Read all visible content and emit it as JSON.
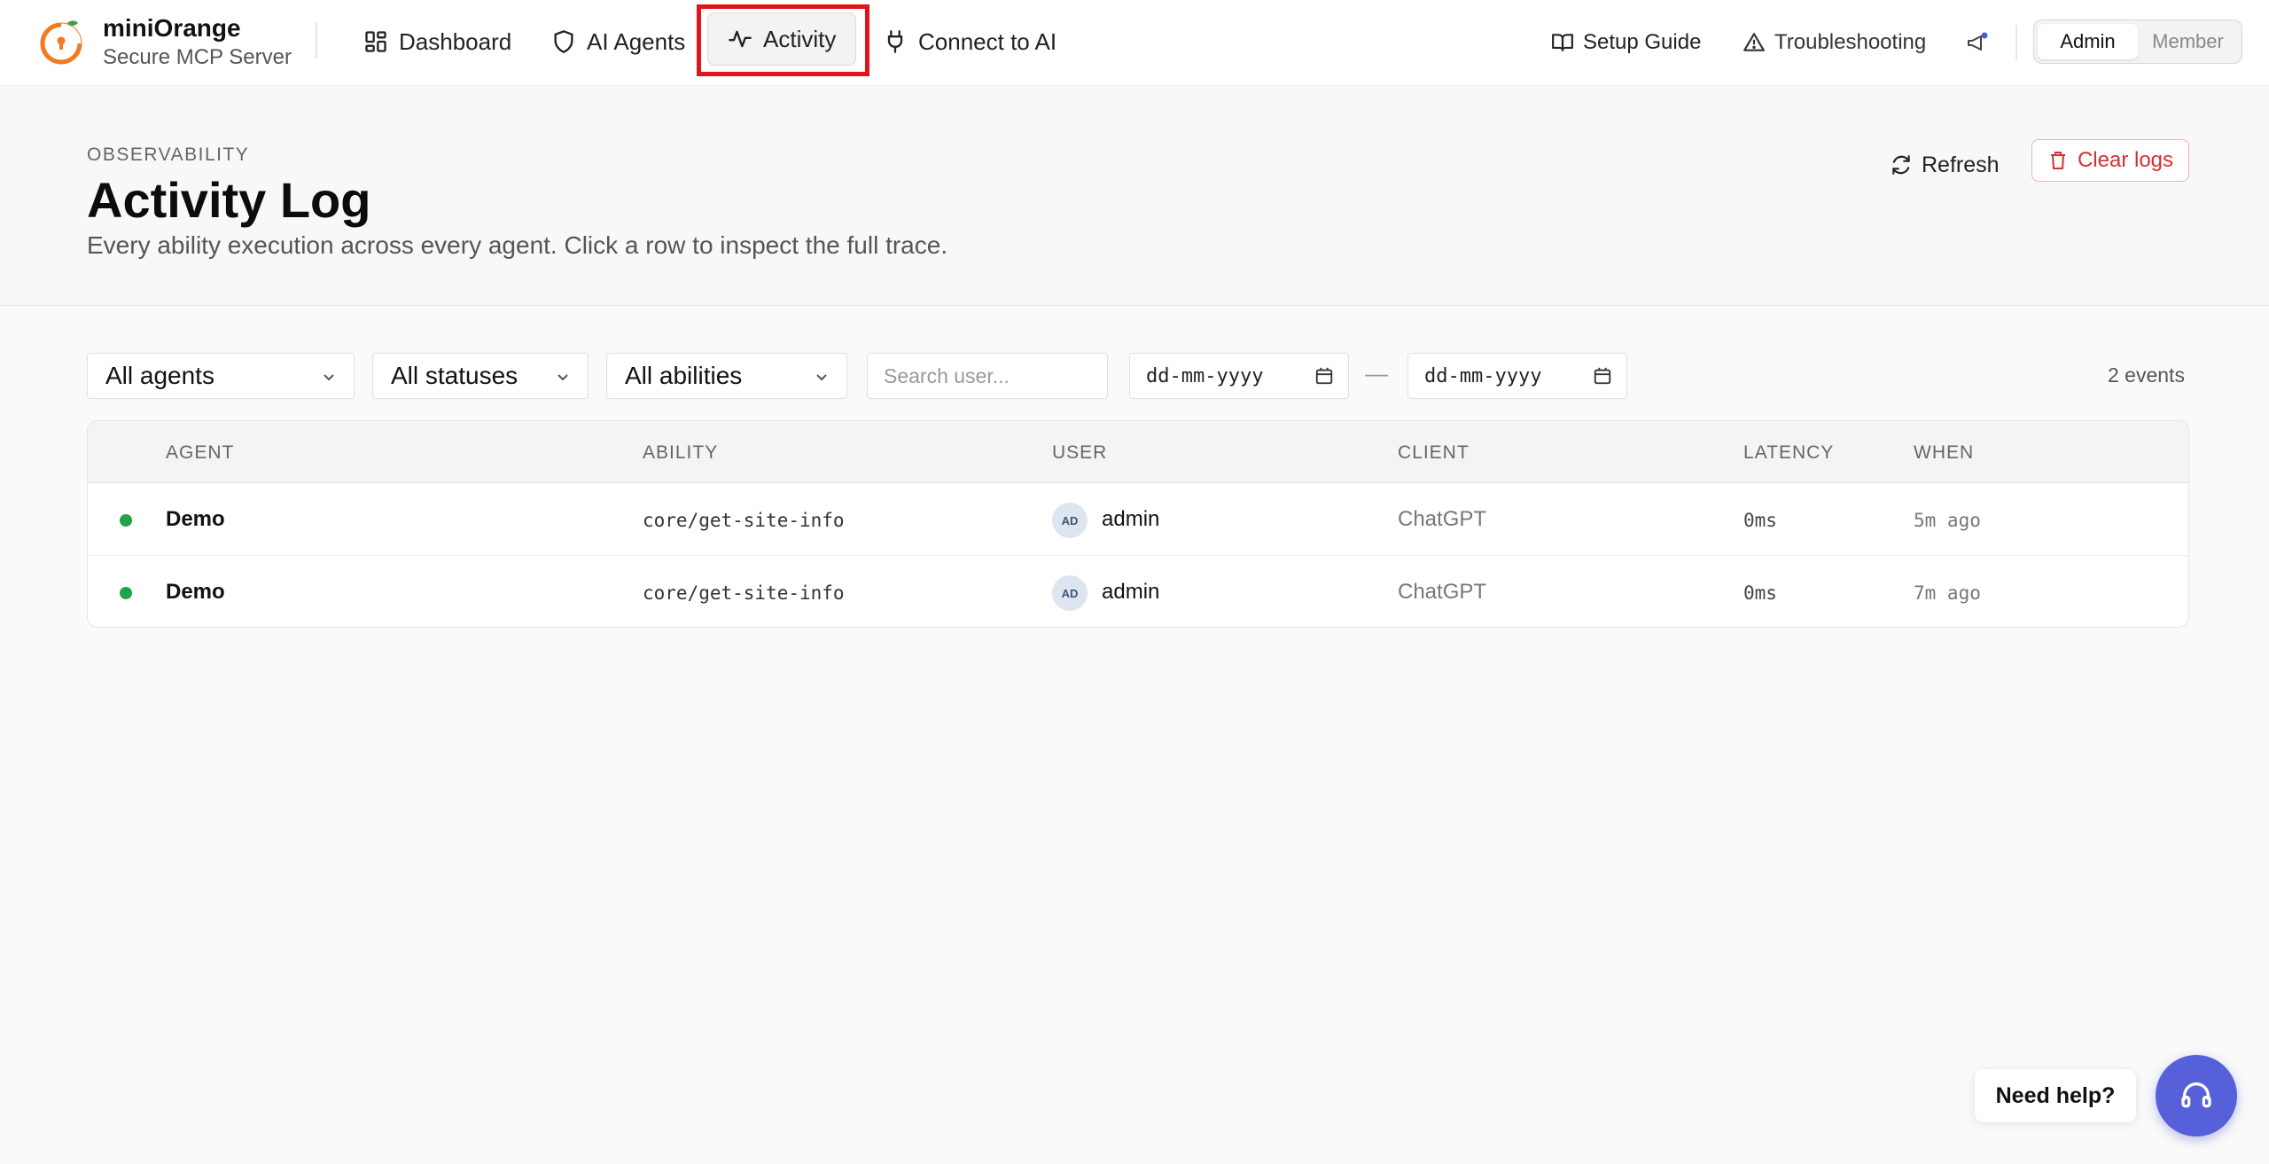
{
  "brand": {
    "name": "miniOrange",
    "subtitle": "Secure MCP Server"
  },
  "nav": {
    "dashboard": "Dashboard",
    "agents": "AI Agents",
    "activity": "Activity",
    "connect": "Connect to AI"
  },
  "utilities": {
    "setup_guide": "Setup Guide",
    "troubleshooting": "Troubleshooting",
    "role_admin": "Admin",
    "role_member": "Member",
    "active_role": "Admin"
  },
  "page": {
    "eyebrow": "OBSERVABILITY",
    "title": "Activity Log",
    "description": "Every ability execution across every agent. Click a row to inspect the full trace.",
    "refresh_label": "Refresh",
    "clear_label": "Clear logs"
  },
  "filters": {
    "agents": "All agents",
    "statuses": "All statuses",
    "abilities": "All abilities",
    "search_placeholder": "Search user...",
    "date_from": "dd-mm-yyyy",
    "date_to": "dd-mm-yyyy",
    "date_separator": "—",
    "events_count": "2 events"
  },
  "table": {
    "headers": {
      "agent": "AGENT",
      "ability": "ABILITY",
      "user": "USER",
      "client": "CLIENT",
      "latency": "LATENCY",
      "when": "WHEN"
    },
    "rows": [
      {
        "agent": "Demo",
        "ability": "core/get-site-info",
        "avatar": "AD",
        "user": "admin",
        "client": "ChatGPT",
        "latency": "0ms",
        "when": "5m ago",
        "status": "success"
      },
      {
        "agent": "Demo",
        "ability": "core/get-site-info",
        "avatar": "AD",
        "user": "admin",
        "client": "ChatGPT",
        "latency": "0ms",
        "when": "7m ago",
        "status": "success"
      }
    ]
  },
  "help": {
    "label": "Need help?"
  },
  "colors": {
    "brand_orange": "#f37a1f",
    "accent_red": "#d23232",
    "status_success": "#22a24a",
    "help_button": "#5660d8",
    "highlight_box": "#e0141c"
  }
}
